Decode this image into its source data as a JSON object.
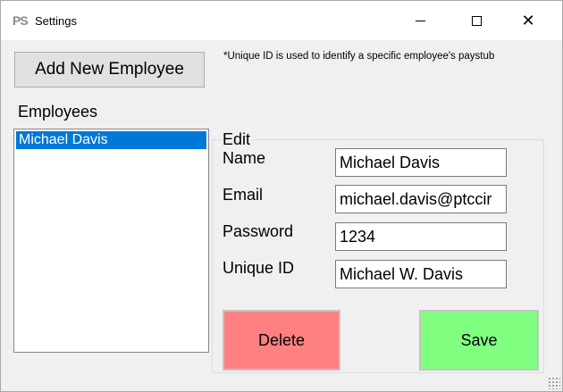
{
  "window": {
    "title": "Settings",
    "app_icon": "PʀS",
    "app_icon_text": "PS",
    "controls": {
      "minimize_icon": "minimize-icon",
      "maximize_icon": "maximize-icon",
      "close_icon": "close-icon",
      "close_glyph": "✕"
    }
  },
  "toolbar": {
    "add_employee_label": "Add New Employee",
    "note": "*Unique ID is used to identify a specific employee's paystub"
  },
  "employees": {
    "label": "Employees",
    "items": [
      {
        "label": "Michael Davis",
        "selected": true
      }
    ]
  },
  "edit": {
    "group_label": "Edit",
    "fields": {
      "name": {
        "label": "Name",
        "value": "Michael Davis"
      },
      "email": {
        "label": "Email",
        "value": "michael.davis@ptccir"
      },
      "password": {
        "label": "Password",
        "value": "1234"
      },
      "unique_id": {
        "label": "Unique ID",
        "value": "Michael W. Davis"
      }
    },
    "delete_label": "Delete",
    "save_label": "Save"
  },
  "colors": {
    "selection": "#0078d7",
    "delete_button": "#ff8080",
    "save_button": "#80ff80",
    "window_background": "#f0f0f0"
  }
}
